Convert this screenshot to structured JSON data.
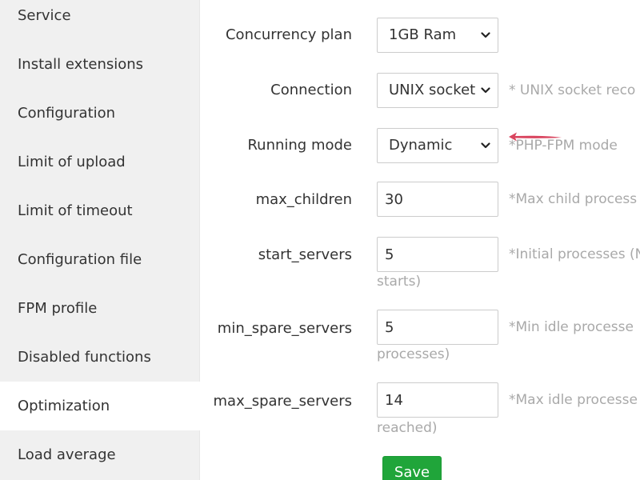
{
  "sidebar": {
    "items": [
      {
        "label": "Service"
      },
      {
        "label": "Install extensions"
      },
      {
        "label": "Configuration"
      },
      {
        "label": "Limit of upload"
      },
      {
        "label": "Limit of timeout"
      },
      {
        "label": "Configuration file"
      },
      {
        "label": "FPM profile"
      },
      {
        "label": "Disabled functions"
      },
      {
        "label": "Optimization",
        "active": true
      },
      {
        "label": "Load average"
      }
    ]
  },
  "form": {
    "concurrency_plan": {
      "label": "Concurrency plan",
      "value": "1GB Ram"
    },
    "connection": {
      "label": "Connection",
      "value": "UNIX socket",
      "hint": "* UNIX socket reco"
    },
    "running_mode": {
      "label": "Running mode",
      "value": "Dynamic",
      "hint": "*PHP-FPM mode"
    },
    "max_children": {
      "label": "max_children",
      "value": "30",
      "hint": "*Max child process"
    },
    "start_servers": {
      "label": "start_servers",
      "value": "5",
      "hint": "*Initial processes (N",
      "hint_cont": "starts)"
    },
    "min_spare_servers": {
      "label": "min_spare_servers",
      "value": "5",
      "hint": "*Min idle processe",
      "hint_cont": "processes)"
    },
    "max_spare_servers": {
      "label": "max_spare_servers",
      "value": "14",
      "hint": "*Max idle processe",
      "hint_cont": "reached)"
    },
    "save_label": "Save"
  },
  "colors": {
    "sidebar_bg": "#f0f0f0",
    "save_green": "#20a53a",
    "hint_gray": "#a9a9a9",
    "arrow_red": "#d9455f"
  }
}
